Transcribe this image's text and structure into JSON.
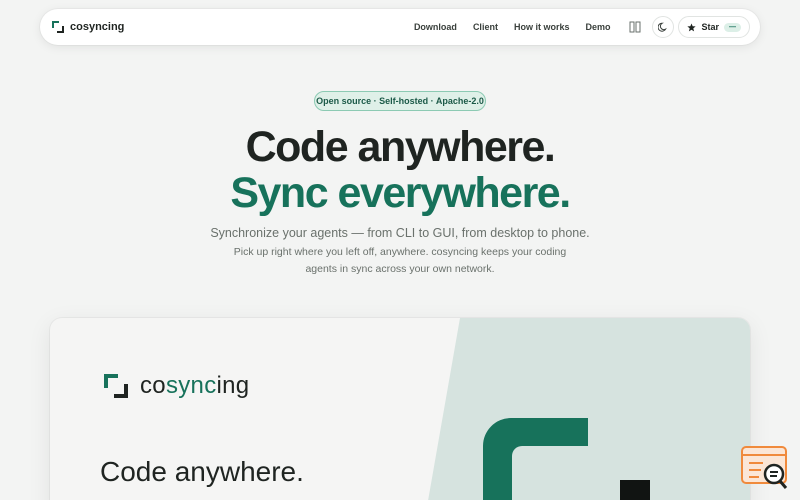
{
  "nav": {
    "brand": "cosyncing",
    "links": [
      "Download",
      "Client",
      "How it works",
      "Demo"
    ],
    "star_label": "Star",
    "star_count": "—",
    "icons": [
      "panels-icon",
      "moon-icon",
      "star-icon"
    ]
  },
  "hero": {
    "badge": "Open source · Self-hosted · Apache-2.0",
    "title_line1": "Code anywhere.",
    "title_line2": "Sync everywhere.",
    "subtitle": "Synchronize your agents — from CLI to GUI, from desktop to phone.",
    "description": "Pick up right where you left off, anywhere. cosyncing keeps your coding agents in sync across your own network."
  },
  "preview": {
    "brand_pre": "co",
    "brand_mid": "sync",
    "brand_post": "ing",
    "headline": "Code anywhere."
  },
  "colors": {
    "accent": "#17725b",
    "background": "#f3f4f3",
    "badge_bg": "#dff0e8",
    "widget": "#f08a3c"
  }
}
